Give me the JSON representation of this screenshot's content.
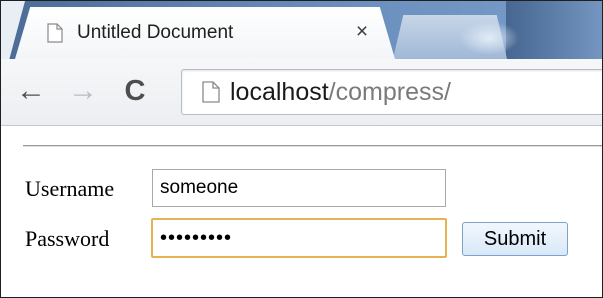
{
  "browser": {
    "tab": {
      "title": "Untitled Document",
      "close_glyph": "×",
      "icon": "page-icon"
    },
    "toolbar": {
      "back_glyph": "←",
      "forward_glyph": "→",
      "reload_glyph": "C",
      "url_host": "localhost",
      "url_path": "/compress/"
    }
  },
  "form": {
    "username_label": "Username",
    "username_value": "someone",
    "password_label": "Password",
    "password_value": "•••••••••",
    "submit_label": "Submit"
  },
  "colors": {
    "focus_border": "#e5b355",
    "button_border": "#7da2ce",
    "tabstrip": "#5f83b1"
  }
}
